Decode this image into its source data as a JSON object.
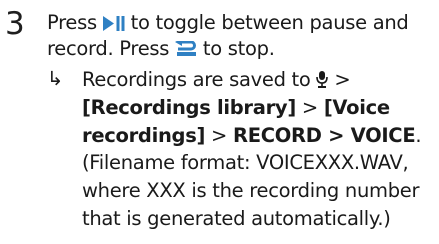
{
  "step": {
    "number": "3",
    "press_1": "Press",
    "toggle_text": "to toggle between pause and record. Press",
    "stop_text": "to stop."
  },
  "result": {
    "arrow": "↳",
    "saved_prefix": "Recordings are saved to",
    "sep_1": ">",
    "recordings_library": "[Recordings library]",
    "sep_2": ">",
    "voice_recordings": "[Voice recordings]",
    "sep_3": ">",
    "record_voice": "RECORD > VOICE",
    "period": ".",
    "filename_note": "(Filename format: VOICEXXX.WAV, where XXX is the recording number that is generated automatically.)"
  },
  "icons": {
    "play_pause": "play-pause-icon",
    "back": "back-arrow-icon",
    "microphone": "microphone-icon",
    "color": "#2f80c3"
  }
}
